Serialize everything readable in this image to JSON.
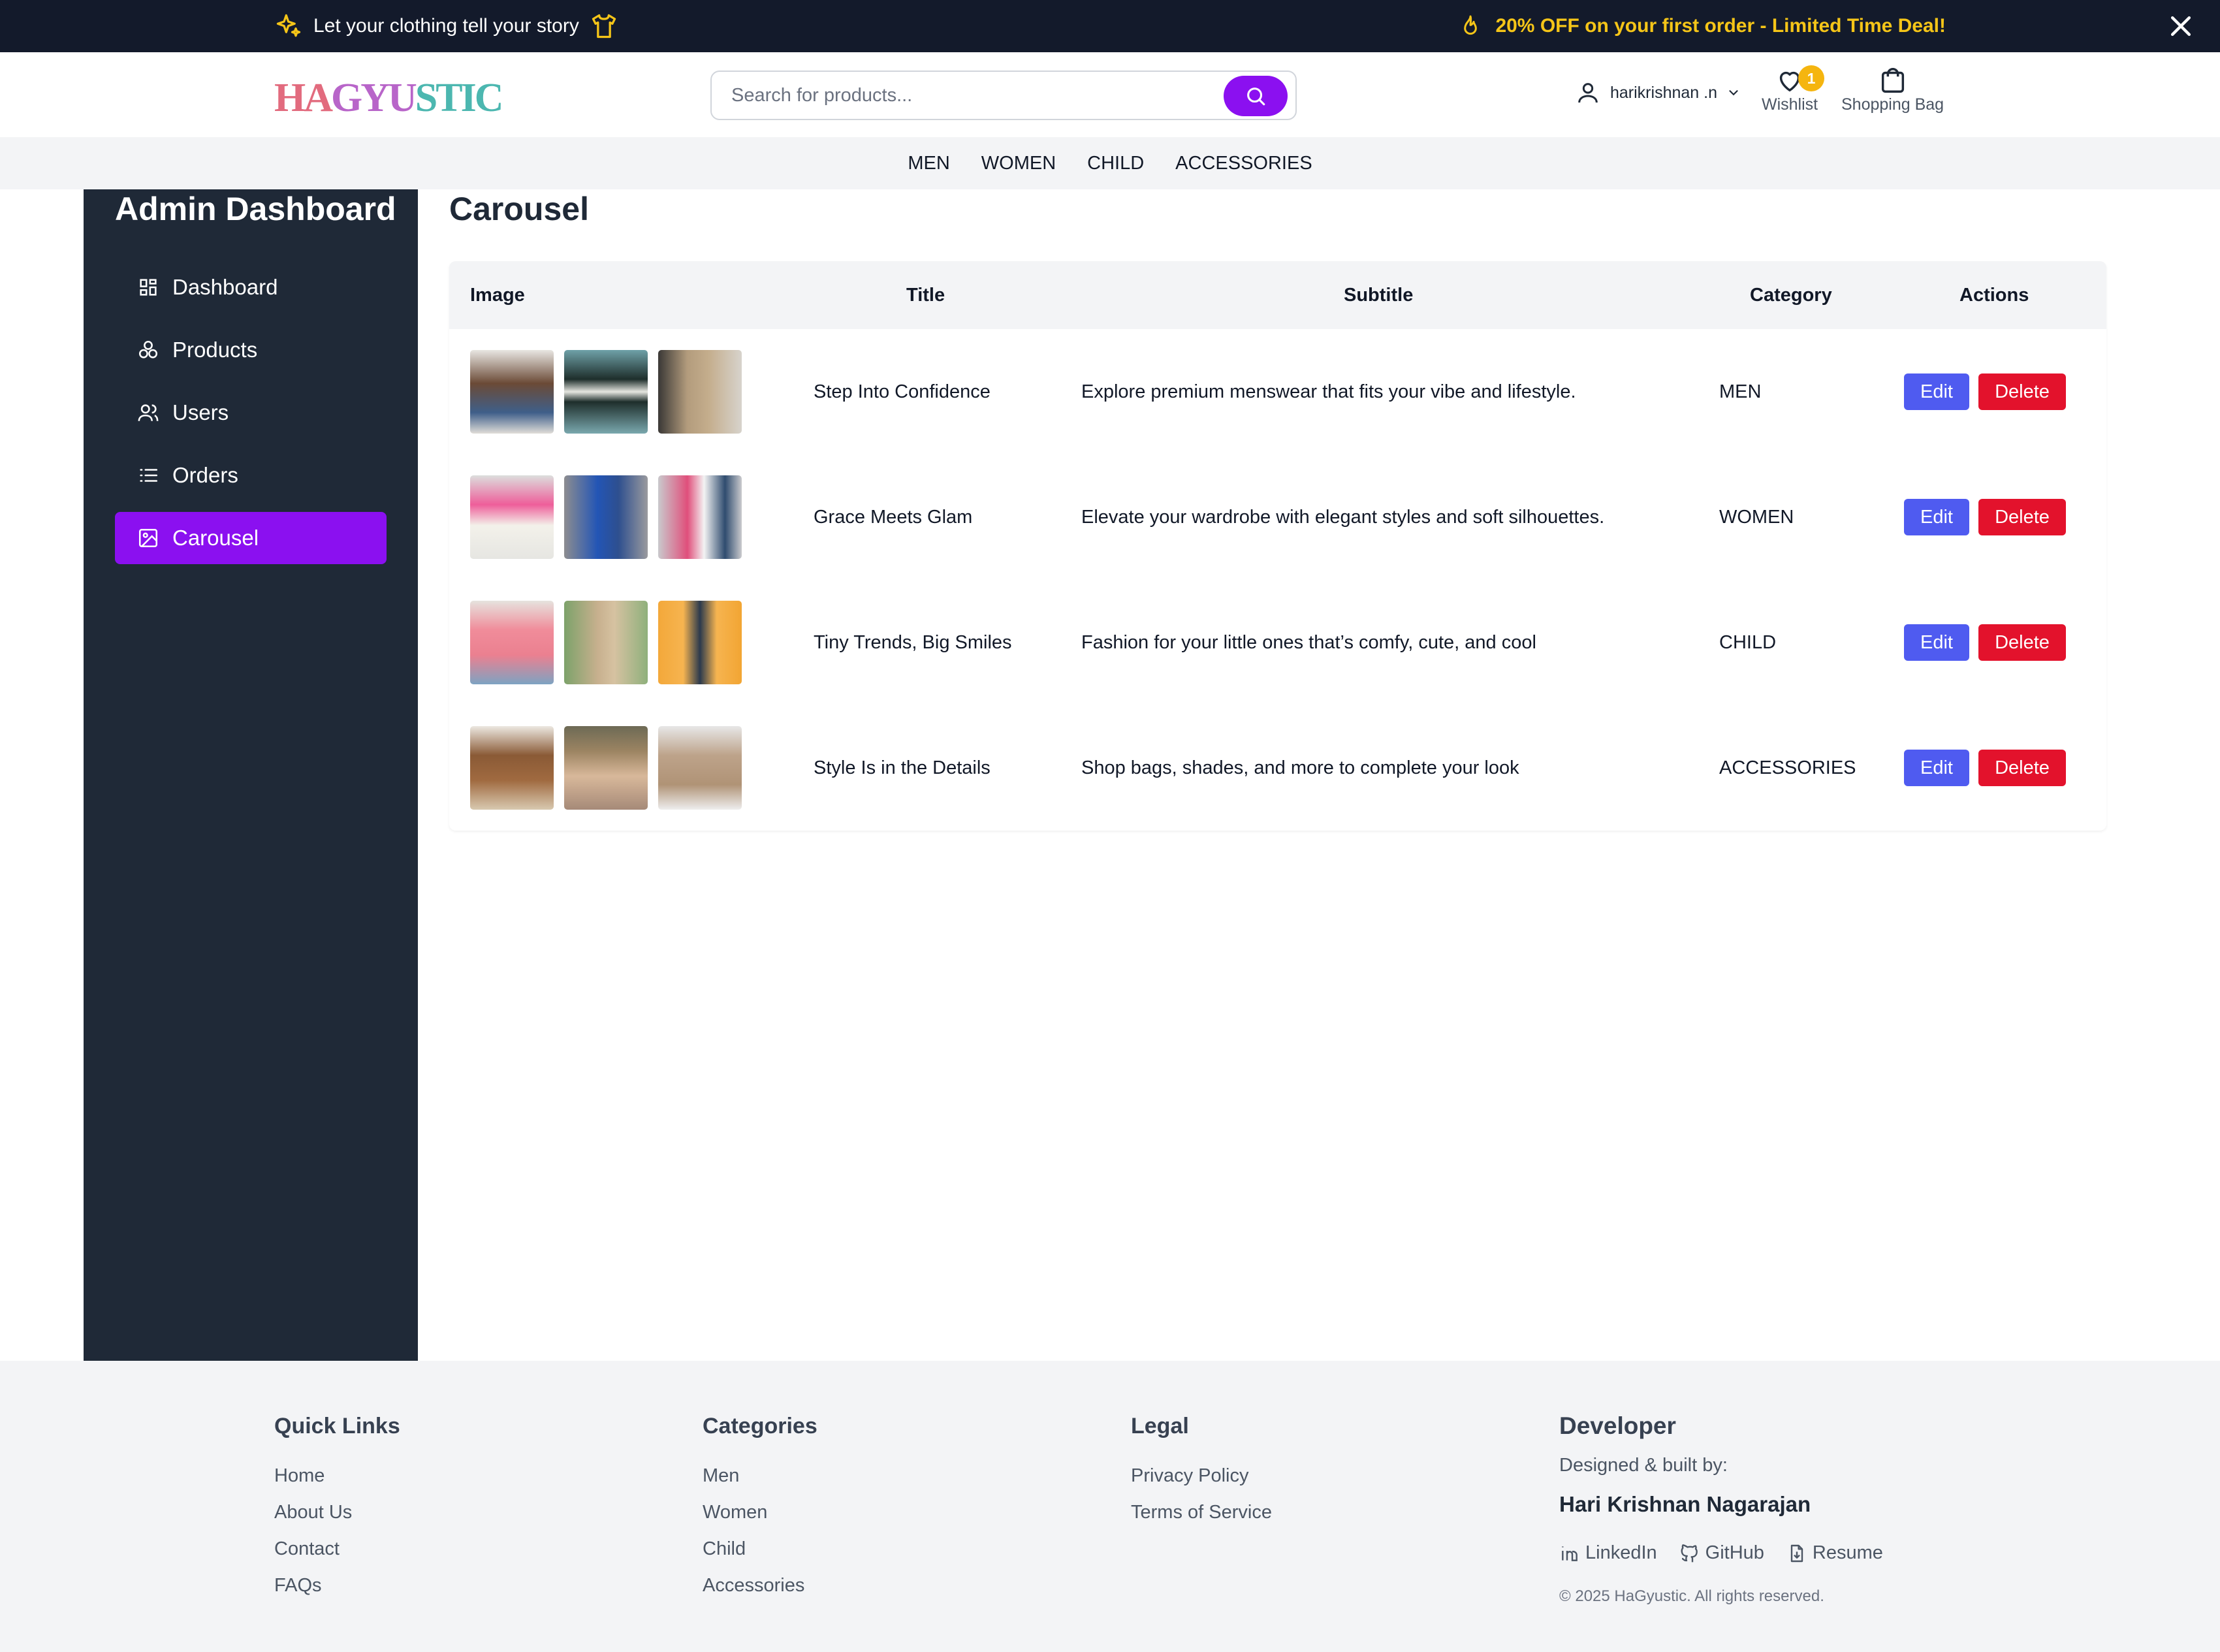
{
  "announcement": {
    "left_text": "Let your clothing tell your story",
    "right_text": "20% OFF on your first order - Limited Time Deal!",
    "accent_color": "#f5c518"
  },
  "header": {
    "logo": {
      "part1": "HA",
      "part2": "GYU",
      "part3": "STIC"
    },
    "search_placeholder": "Search for products...",
    "user_name": "harikrishnan .n",
    "wishlist_label": "Wishlist",
    "wishlist_count": "1",
    "bag_label": "Shopping Bag",
    "brand_color": "#8b10f0"
  },
  "nav": [
    "MEN",
    "WOMEN",
    "CHILD",
    "ACCESSORIES"
  ],
  "sidebar": {
    "title": "Admin Dashboard",
    "items": [
      {
        "label": "Dashboard",
        "icon": "grid-icon",
        "active": false
      },
      {
        "label": "Products",
        "icon": "boxes-icon",
        "active": false
      },
      {
        "label": "Users",
        "icon": "users-icon",
        "active": false
      },
      {
        "label": "Orders",
        "icon": "list-icon",
        "active": false
      },
      {
        "label": "Carousel",
        "icon": "image-icon",
        "active": true
      }
    ]
  },
  "main": {
    "title": "Carousel",
    "columns": [
      "Image",
      "Title",
      "Subtitle",
      "Category",
      "Actions"
    ],
    "edit_label": "Edit",
    "delete_label": "Delete",
    "rows": [
      {
        "title": "Step Into Confidence",
        "subtitle": "Explore premium menswear that fits your vibe and lifestyle.",
        "category": "MEN"
      },
      {
        "title": "Grace Meets Glam",
        "subtitle": "Elevate your wardrobe with elegant styles and soft silhouettes.",
        "category": "WOMEN"
      },
      {
        "title": "Tiny Trends, Big Smiles",
        "subtitle": "Fashion for your little ones that’s comfy, cute, and cool",
        "category": "CHILD"
      },
      {
        "title": "Style Is in the Details",
        "subtitle": "Shop bags, shades, and more to complete your look",
        "category": "ACCESSORIES"
      }
    ]
  },
  "footer": {
    "quick_links": {
      "heading": "Quick Links",
      "items": [
        "Home",
        "About Us",
        "Contact",
        "FAQs"
      ]
    },
    "categories": {
      "heading": "Categories",
      "items": [
        "Men",
        "Women",
        "Child",
        "Accessories"
      ]
    },
    "legal": {
      "heading": "Legal",
      "items": [
        "Privacy Policy",
        "Terms of Service"
      ]
    },
    "developer": {
      "heading": "Developer",
      "built_by": "Designed & built by:",
      "name": "Hari Krishnan Nagarajan",
      "links": [
        "LinkedIn",
        "GitHub",
        "Resume"
      ],
      "copyright": "© 2025 HaGyustic. All rights reserved."
    }
  }
}
